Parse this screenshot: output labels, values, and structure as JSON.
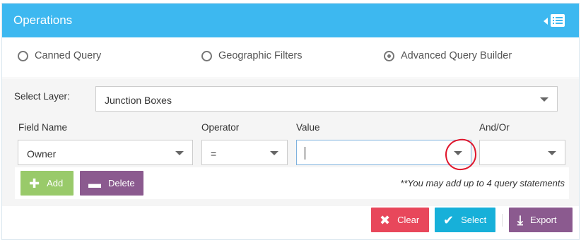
{
  "header": {
    "title": "Operations",
    "collapse_icon": "collapse-list-icon"
  },
  "query_types": [
    {
      "label": "Canned Query",
      "checked": false
    },
    {
      "label": "Geographic Filters",
      "checked": false
    },
    {
      "label": "Advanced Query Builder",
      "checked": true
    }
  ],
  "layer": {
    "label": "Select Layer:",
    "value": "Junction Boxes"
  },
  "columns": {
    "field": "Field Name",
    "operator": "Operator",
    "value": "Value",
    "andor": "And/Or"
  },
  "row": {
    "field": "Owner",
    "operator": "=",
    "value": "",
    "andor": ""
  },
  "buttons": {
    "add": "Add",
    "delete": "Delete",
    "clear": "Clear",
    "select": "Select",
    "export": "Export"
  },
  "hint": "**You may add up to 4 query statements",
  "colors": {
    "header": "#3db8f0",
    "add": "#99ca6a",
    "delete": "#8b5a8f",
    "clear": "#e8475b",
    "select": "#17b0d9",
    "export": "#8b5a8f",
    "annotation": "#e0152b"
  }
}
